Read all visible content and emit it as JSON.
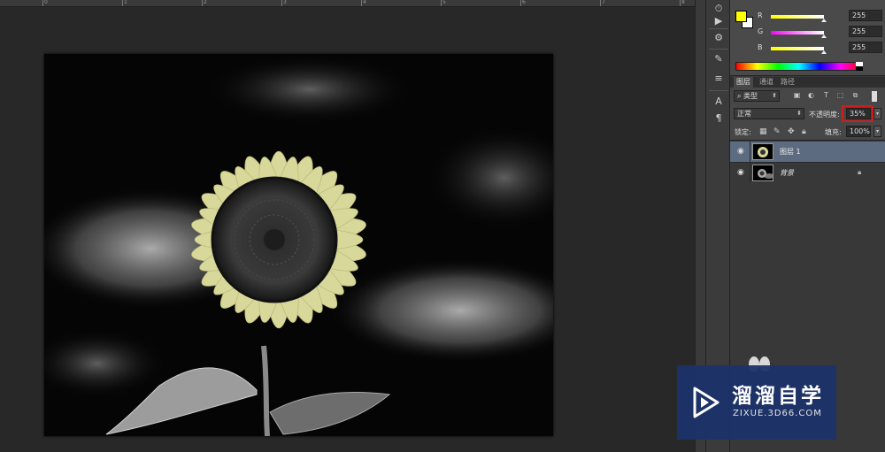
{
  "ruler": {
    "numbers": [
      "0",
      "1",
      "2",
      "3",
      "4",
      "5",
      "6",
      "7",
      "8"
    ]
  },
  "color_panel": {
    "foreground_color": "#ffff00",
    "background_color": "#ffffff",
    "sliders": [
      {
        "label": "R",
        "value": "255",
        "track_color": "#00ffff"
      },
      {
        "label": "G",
        "value": "255",
        "track_color": "#ff00ff"
      },
      {
        "label": "B",
        "value": "255",
        "track_color": "#ffff00"
      }
    ]
  },
  "layers_panel": {
    "tabs": [
      "图层",
      "通道",
      "路径"
    ],
    "active_tab": "图层",
    "filter_kind": "类型",
    "blend_mode": "正常",
    "opacity_label": "不透明度:",
    "opacity_value": "35%",
    "lock_label": "锁定:",
    "fill_label": "填充:",
    "fill_value": "100%",
    "layers": [
      {
        "name": "图层 1",
        "selected": true,
        "visible": true,
        "locked": false
      },
      {
        "name": "背景",
        "selected": false,
        "visible": true,
        "locked": true
      }
    ]
  },
  "watermark": {
    "title": "溜溜自学",
    "url": "ZIXUE.3D66.COM",
    "color": "#1b3168"
  }
}
